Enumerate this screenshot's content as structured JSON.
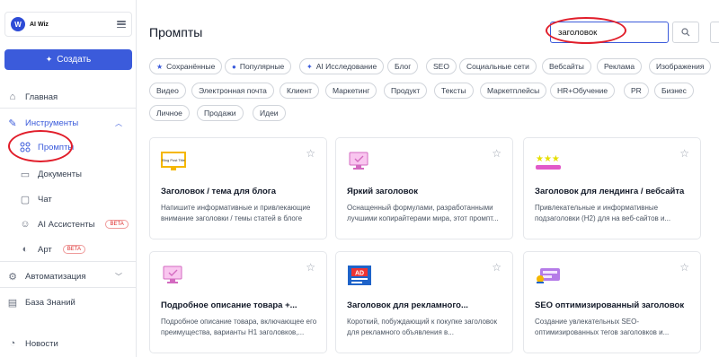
{
  "sidebar": {
    "logo_badge": "W",
    "logo_text": "AI Wiz",
    "create_label": "Создать",
    "items": [
      {
        "label": "Главная"
      },
      {
        "label": "Инструменты"
      },
      {
        "label": "Промпты"
      },
      {
        "label": "Документы"
      },
      {
        "label": "Чат"
      },
      {
        "label": "AI Ассистенты",
        "badge": "BETA"
      },
      {
        "label": "Арт",
        "badge": "BETA"
      },
      {
        "label": "Автоматизация"
      },
      {
        "label": "База Знаний"
      },
      {
        "label": "Новости"
      }
    ]
  },
  "header": {
    "title": "Промпты",
    "search_value": "заголовок"
  },
  "chips": [
    {
      "label": "Сохранённые",
      "icon": "star-icon"
    },
    {
      "label": "Популярные",
      "icon": "drop-icon"
    },
    {
      "label": "AI Исследование",
      "icon": "sparkle-icon"
    },
    {
      "label": "Блог"
    },
    {
      "label": "SEO"
    },
    {
      "label": "Социальные сети"
    },
    {
      "label": "Вебсайты"
    },
    {
      "label": "Реклама"
    },
    {
      "label": "Изображения"
    },
    {
      "label": "Видео"
    },
    {
      "label": "Электронная почта"
    },
    {
      "label": "Клиент"
    },
    {
      "label": "Маркетинг"
    },
    {
      "label": "Продукт"
    },
    {
      "label": "Тексты"
    },
    {
      "label": "Маркетплейсы"
    },
    {
      "label": "HR+Обучение"
    },
    {
      "label": "PR"
    },
    {
      "label": "Бизнес"
    },
    {
      "label": "Личное"
    },
    {
      "label": "Продажи"
    },
    {
      "label": "Идеи"
    }
  ],
  "cards": [
    {
      "title": "Заголовок / тема для блога",
      "desc": "Напишите информативные и привлекающие внимание заголовки / темы статей в блоге",
      "thumb": "blog-title-icon",
      "thumb_text": "Blog Post Title"
    },
    {
      "title": "Яркий заголовок",
      "desc": "Оснащенный формулами, разработанными лучшими копирайтерами мира, этот промпт...",
      "thumb": "monitor-icon"
    },
    {
      "title": "Заголовок для лендинга / вебсайта",
      "desc": "Привлекательные и информативные подзаголовки (H2) для на веб-сайтов и...",
      "thumb": "stars-icon"
    },
    {
      "title": "Подробное описание товара +...",
      "desc": "Подробное описание товара, включающее его преимущества, варианты H1 заголовков,...",
      "thumb": "monitor-icon"
    },
    {
      "title": "Заголовок для рекламного...",
      "desc": "Короткий, побуждающий к покупке заголовок для рекламного объявления в...",
      "thumb": "ad-icon",
      "thumb_text": "AD"
    },
    {
      "title": "SEO оптимизированный заголовок",
      "desc": "Создание увлекательных SEO-оптимизированных тегов заголовков и...",
      "thumb": "seo-icon"
    }
  ],
  "colors": {
    "accent": "#3b5bdb",
    "annotation": "#e11d2a"
  }
}
